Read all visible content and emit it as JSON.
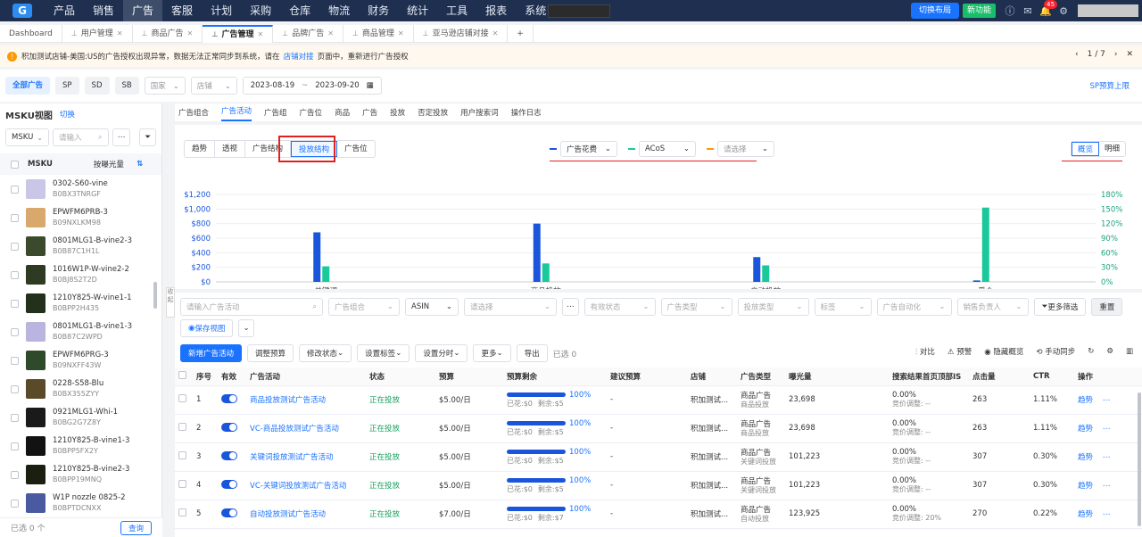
{
  "topnav": {
    "logo": "G",
    "menu": [
      "产品",
      "销售",
      "广告",
      "客服",
      "计划",
      "采购",
      "仓库",
      "物流",
      "财务",
      "统计",
      "工具",
      "报表",
      "系统"
    ],
    "active_menu": "广告",
    "layout_btn": "切换布局",
    "new_feature_btn": "新功能",
    "notif_count": "45"
  },
  "tabs": [
    "Dashboard",
    "用户管理",
    "商品广告",
    "广告管理",
    "品牌广告",
    "商品管理",
    "亚马逊店铺对接"
  ],
  "active_tab": "广告管理",
  "warning": {
    "text": "积加测试店铺-美国:US的广告授权出现异常，数据无法正常同步到系统，请在",
    "link": "店铺对接",
    "text2": "页面中，重新进行广告授权",
    "pager": "1 / 7"
  },
  "filters": {
    "segments": [
      "全部广告",
      "SP",
      "SD",
      "SB"
    ],
    "country": "国家",
    "shop": "店铺",
    "date_from": "2023-08-19",
    "date_sep": "~",
    "date_to": "2023-09-20",
    "sp_link": "SP预算上限"
  },
  "sidebar": {
    "title": "MSKU视图",
    "switch": "切换",
    "select": "MSKU",
    "placeholder": "请输入",
    "col": "MSKU",
    "sort": "按曝光量",
    "items": [
      {
        "name": "0302-S60-vine",
        "asin": "B0BX3TNRGF",
        "color": "#c9c6e8"
      },
      {
        "name": "EPWFM6PRB-3",
        "asin": "B09NXLKM98",
        "color": "#d9a86c"
      },
      {
        "name": "0801MLG1-B-vine2-3",
        "asin": "B0B87C1H1L",
        "color": "#3b4a2c"
      },
      {
        "name": "1016W1P-W-vine2-2",
        "asin": "B0BJ8S2T2D",
        "color": "#2e3a22"
      },
      {
        "name": "1210Y825-W-vine1-1",
        "asin": "B0BPP2H435",
        "color": "#23301c"
      },
      {
        "name": "0801MLG1-B-vine1-3",
        "asin": "B0B87C2WPD",
        "color": "#b9b4e0"
      },
      {
        "name": "EPWFM6PRG-3",
        "asin": "B09NXFF43W",
        "color": "#2e4a2a"
      },
      {
        "name": "0228-S58-Blu",
        "asin": "B0BX355ZYY",
        "color": "#5a4a2a"
      },
      {
        "name": "0921MLG1-Whi-1",
        "asin": "B0BG2G7Z8Y",
        "color": "#1a1a1a"
      },
      {
        "name": "1210Y825-B-vine1-3",
        "asin": "B0BPP5FX2Y",
        "color": "#121212"
      },
      {
        "name": "1210Y825-B-vine2-3",
        "asin": "B0BPP19MNQ",
        "color": "#1b1f10"
      },
      {
        "name": "W1P nozzle 0825-2",
        "asin": "B0BPTDCNXX",
        "color": "#4a5aa0"
      }
    ],
    "selected": "已选 0 个",
    "query_btn": "查询",
    "collapse": "收起"
  },
  "subtabs": [
    "广告组合",
    "广告活动",
    "广告组",
    "广告位",
    "商品",
    "广告",
    "投放",
    "否定投放",
    "用户搜索词",
    "操作日志"
  ],
  "active_subtab": "广告活动",
  "chart_tabs": [
    "趋势",
    "透视",
    "广告结构",
    "投放结构",
    "广告位"
  ],
  "active_chart_tab": "投放结构",
  "metric_selects": [
    {
      "label": "广告花费",
      "color": "#1a56db"
    },
    {
      "label": "ACoS",
      "color": "#19c99b"
    },
    {
      "label": "请选择",
      "color": "#ff9900"
    }
  ],
  "view_toggle": [
    "概览",
    "明细"
  ],
  "chart_data": {
    "type": "bar",
    "categories": [
      "关键词",
      "商品投放",
      "自动投放",
      "受众"
    ],
    "series": [
      {
        "name": "广告花费",
        "axis": "left",
        "values": [
          680,
          800,
          340,
          20
        ],
        "color": "#1a56db"
      },
      {
        "name": "ACoS",
        "axis": "right",
        "values": [
          32,
          38,
          34,
          153
        ],
        "color": "#19c99b"
      }
    ],
    "ylim_left": [
      0,
      1200
    ],
    "ylim_right": [
      0,
      180
    ],
    "yticks_left": [
      "$0",
      "$200",
      "$400",
      "$600",
      "$800",
      "$1,000",
      "$1,200"
    ],
    "yticks_right": [
      "0%",
      "30%",
      "60%",
      "90%",
      "120%",
      "150%",
      "180%"
    ]
  },
  "toolbar": {
    "search_placeholder": "请输入广告活动",
    "portfolio": "广告组合",
    "asin": "ASIN",
    "asin_ph": "请选择",
    "status": "有效状态",
    "ad_type": "广告类型",
    "target_type": "投放类型",
    "tag": "标签",
    "auto": "广告自动化",
    "owner": "销售负责人",
    "more_filter": "更多筛选",
    "reset": "重置",
    "save_view": "保存视图",
    "new_btn": "新增广告活动",
    "budget": "调整预算",
    "modify": "修改状态",
    "tags": "设置标签",
    "dayparting": "设置分时",
    "more": "更多",
    "export": "导出",
    "selected": "已选 0",
    "compare": "对比",
    "alert": "预警",
    "hide": "隐藏概览",
    "sync": "手动同步"
  },
  "table": {
    "headers": [
      "序号",
      "有效",
      "广告活动",
      "状态",
      "预算",
      "预算剩余",
      "建议预算",
      "店铺",
      "广告类型",
      "曝光量",
      "搜索结果首页顶部IS",
      "点击量",
      "CTR",
      "操作"
    ],
    "rows": [
      {
        "no": "1",
        "name": "商品投放测试广告活动",
        "status": "正在投放",
        "budget": "$5.00/日",
        "pct": "100%",
        "spent": "已花:$0",
        "left": "剩余:$5",
        "sug": "-",
        "shop": "积加测试...",
        "type": "商品广告",
        "type2": "商品投放",
        "imp": "23,698",
        "is": "0.00%",
        "is2": "竞价调整: --",
        "clk": "263",
        "ctr": "1.11%",
        "op": "趋势"
      },
      {
        "no": "2",
        "name": "VC-商品投放测试广告活动",
        "status": "正在投放",
        "budget": "$5.00/日",
        "pct": "100%",
        "spent": "已花:$0",
        "left": "剩余:$5",
        "sug": "-",
        "shop": "积加测试...",
        "type": "商品广告",
        "type2": "商品投放",
        "imp": "23,698",
        "is": "0.00%",
        "is2": "竞价调整: --",
        "clk": "263",
        "ctr": "1.11%",
        "op": "趋势"
      },
      {
        "no": "3",
        "name": "关键词投放测试广告活动",
        "status": "正在投放",
        "budget": "$5.00/日",
        "pct": "100%",
        "spent": "已花:$0",
        "left": "剩余:$5",
        "sug": "-",
        "shop": "积加测试...",
        "type": "商品广告",
        "type2": "关键词投放",
        "imp": "101,223",
        "is": "0.00%",
        "is2": "竞价调整: --",
        "clk": "307",
        "ctr": "0.30%",
        "op": "趋势"
      },
      {
        "no": "4",
        "name": "VC-关键词投放测试广告活动",
        "status": "正在投放",
        "budget": "$5.00/日",
        "pct": "100%",
        "spent": "已花:$0",
        "left": "剩余:$5",
        "sug": "-",
        "shop": "积加测试...",
        "type": "商品广告",
        "type2": "关键词投放",
        "imp": "101,223",
        "is": "0.00%",
        "is2": "竞价调整: --",
        "clk": "307",
        "ctr": "0.30%",
        "op": "趋势"
      },
      {
        "no": "5",
        "name": "自动投放测试广告活动",
        "status": "正在投放",
        "budget": "$7.00/日",
        "pct": "100%",
        "spent": "已花:$0",
        "left": "剩余:$7",
        "sug": "-",
        "shop": "积加测试...",
        "type": "商品广告",
        "type2": "自动投放",
        "imp": "123,925",
        "is": "0.00%",
        "is2": "竞价调整: 20%",
        "clk": "270",
        "ctr": "0.22%",
        "op": "趋势"
      }
    ]
  }
}
